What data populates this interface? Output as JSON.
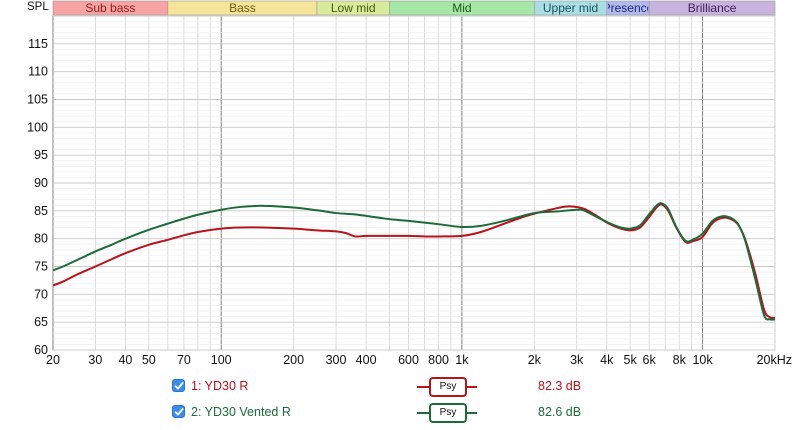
{
  "chart_data": {
    "type": "line",
    "ylabel": "SPL",
    "x_scale": "log",
    "xlim": [
      20,
      20000
    ],
    "ylim": [
      60,
      120
    ],
    "grid": true,
    "x_ticks": [
      {
        "value": 20,
        "label": "20"
      },
      {
        "value": 30,
        "label": "30"
      },
      {
        "value": 40,
        "label": "40"
      },
      {
        "value": 50,
        "label": "50"
      },
      {
        "value": 70,
        "label": "70"
      },
      {
        "value": 100,
        "label": "100"
      },
      {
        "value": 200,
        "label": "200"
      },
      {
        "value": 300,
        "label": "300"
      },
      {
        "value": 400,
        "label": "400"
      },
      {
        "value": 600,
        "label": "600"
      },
      {
        "value": 800,
        "label": "800"
      },
      {
        "value": 1000,
        "label": "1k"
      },
      {
        "value": 2000,
        "label": "2k"
      },
      {
        "value": 3000,
        "label": "3k"
      },
      {
        "value": 4000,
        "label": "4k"
      },
      {
        "value": 5000,
        "label": "5k"
      },
      {
        "value": 6000,
        "label": "6k"
      },
      {
        "value": 8000,
        "label": "8k"
      },
      {
        "value": 10000,
        "label": "10k"
      },
      {
        "value": 20000,
        "label": "20kHz"
      }
    ],
    "y_ticks": [
      60,
      65,
      70,
      75,
      80,
      85,
      90,
      95,
      100,
      105,
      110,
      115
    ],
    "bands": [
      {
        "label": "Sub bass",
        "from": 20,
        "to": 60,
        "color": "#f5a3a3",
        "text_color": "#8a1f1f"
      },
      {
        "label": "Bass",
        "from": 60,
        "to": 250,
        "color": "#f6e49a",
        "text_color": "#6b5a10"
      },
      {
        "label": "Low mid",
        "from": 250,
        "to": 500,
        "color": "#d9eb9a",
        "text_color": "#3f5a10"
      },
      {
        "label": "Mid",
        "from": 500,
        "to": 2000,
        "color": "#a6e6a6",
        "text_color": "#1d5a1d"
      },
      {
        "label": "Upper mid",
        "from": 2000,
        "to": 4000,
        "color": "#a9dfe3",
        "text_color": "#1d5060"
      },
      {
        "label": "Presence",
        "from": 4000,
        "to": 6000,
        "color": "#b2b9ec",
        "text_color": "#1f2a7a"
      },
      {
        "label": "Brilliance",
        "from": 6000,
        "to": 20000,
        "color": "#c8b2de",
        "text_color": "#3f1f5a"
      }
    ],
    "series": [
      {
        "name": "1: YD30 R",
        "color": "#b8121b",
        "style_label": "Psy",
        "value_label": "82.3 dB",
        "points": [
          [
            20,
            71.6
          ],
          [
            22,
            72.3
          ],
          [
            25,
            73.5
          ],
          [
            30,
            75.0
          ],
          [
            35,
            76.3
          ],
          [
            40,
            77.4
          ],
          [
            50,
            78.9
          ],
          [
            60,
            79.8
          ],
          [
            70,
            80.6
          ],
          [
            80,
            81.2
          ],
          [
            100,
            81.8
          ],
          [
            120,
            82.0
          ],
          [
            150,
            82.0
          ],
          [
            200,
            81.8
          ],
          [
            250,
            81.5
          ],
          [
            300,
            81.3
          ],
          [
            330,
            81.0
          ],
          [
            360,
            80.4
          ],
          [
            400,
            80.5
          ],
          [
            500,
            80.5
          ],
          [
            600,
            80.5
          ],
          [
            700,
            80.4
          ],
          [
            800,
            80.4
          ],
          [
            1000,
            80.5
          ],
          [
            1200,
            81.2
          ],
          [
            1500,
            82.7
          ],
          [
            1800,
            83.9
          ],
          [
            2000,
            84.5
          ],
          [
            2500,
            85.5
          ],
          [
            2800,
            85.8
          ],
          [
            3200,
            85.4
          ],
          [
            3600,
            84.2
          ],
          [
            4000,
            82.9
          ],
          [
            4500,
            81.9
          ],
          [
            5000,
            81.5
          ],
          [
            5500,
            82.0
          ],
          [
            6000,
            83.9
          ],
          [
            6500,
            85.8
          ],
          [
            6800,
            86.1
          ],
          [
            7200,
            85.0
          ],
          [
            7800,
            81.9
          ],
          [
            8500,
            79.4
          ],
          [
            9200,
            79.6
          ],
          [
            10000,
            80.3
          ],
          [
            11000,
            82.8
          ],
          [
            12000,
            83.7
          ],
          [
            13000,
            83.6
          ],
          [
            14000,
            82.6
          ],
          [
            15000,
            80.0
          ],
          [
            16500,
            74.0
          ],
          [
            18000,
            67.3
          ],
          [
            19000,
            65.9
          ],
          [
            20000,
            65.8
          ]
        ]
      },
      {
        "name": "2: YD30 Vented R",
        "color": "#1d6a3a",
        "style_label": "Psy",
        "value_label": "82.6 dB",
        "points": [
          [
            20,
            74.3
          ],
          [
            22,
            75.0
          ],
          [
            25,
            76.1
          ],
          [
            30,
            77.7
          ],
          [
            35,
            78.9
          ],
          [
            40,
            80.0
          ],
          [
            50,
            81.6
          ],
          [
            60,
            82.7
          ],
          [
            70,
            83.6
          ],
          [
            80,
            84.3
          ],
          [
            100,
            85.2
          ],
          [
            120,
            85.7
          ],
          [
            150,
            85.9
          ],
          [
            200,
            85.6
          ],
          [
            250,
            85.1
          ],
          [
            300,
            84.6
          ],
          [
            350,
            84.4
          ],
          [
            400,
            84.1
          ],
          [
            500,
            83.5
          ],
          [
            600,
            83.2
          ],
          [
            800,
            82.6
          ],
          [
            1000,
            82.1
          ],
          [
            1200,
            82.3
          ],
          [
            1500,
            83.2
          ],
          [
            2000,
            84.6
          ],
          [
            2500,
            84.9
          ],
          [
            3000,
            85.2
          ],
          [
            3200,
            85.1
          ],
          [
            3600,
            84.0
          ],
          [
            4000,
            83.0
          ],
          [
            4500,
            82.1
          ],
          [
            5000,
            81.8
          ],
          [
            5500,
            82.4
          ],
          [
            6000,
            84.4
          ],
          [
            6500,
            86.1
          ],
          [
            6800,
            86.3
          ],
          [
            7200,
            85.3
          ],
          [
            7800,
            82.0
          ],
          [
            8500,
            79.6
          ],
          [
            9200,
            79.9
          ],
          [
            10000,
            80.9
          ],
          [
            11000,
            83.2
          ],
          [
            12000,
            84.0
          ],
          [
            13000,
            83.8
          ],
          [
            14000,
            82.7
          ],
          [
            15000,
            79.8
          ],
          [
            16500,
            73.0
          ],
          [
            18000,
            66.3
          ],
          [
            19000,
            65.5
          ],
          [
            20000,
            65.5
          ]
        ]
      }
    ]
  }
}
